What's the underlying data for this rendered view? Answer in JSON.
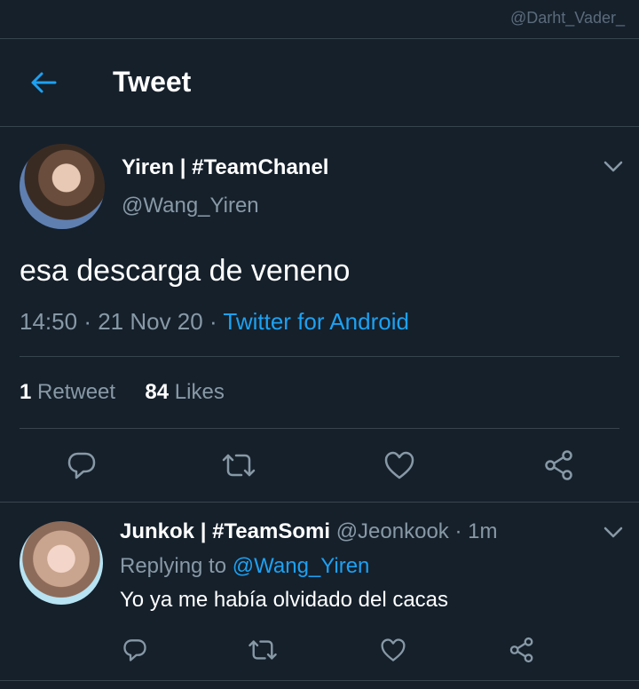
{
  "watermark": "@Darht_Vader_",
  "header": {
    "title": "Tweet"
  },
  "tweet": {
    "author_name": "Yiren | #TeamChanel",
    "author_handle": "@Wang_Yiren",
    "text": "esa descarga de veneno",
    "time": "14:50",
    "date": "21 Nov 20",
    "source": "Twitter for Android",
    "retweet_count": "1",
    "retweet_label": "Retweet",
    "like_count": "84",
    "like_label": "Likes"
  },
  "reply": {
    "author_name": "Junkok | #TeamSomi",
    "author_handle": "@Jeonkook",
    "age": "1m",
    "replying_label": "Replying to",
    "replying_handle": "@Wang_Yiren",
    "text": "Yo ya me había olvidado del cacas"
  },
  "icons": [
    "back-arrow-icon",
    "chevron-down-icon",
    "reply-icon",
    "retweet-icon",
    "like-icon",
    "share-icon"
  ],
  "colors": {
    "background": "#15202b",
    "accent": "#1da1f2",
    "muted": "#8899a6",
    "divider": "#38444d"
  }
}
